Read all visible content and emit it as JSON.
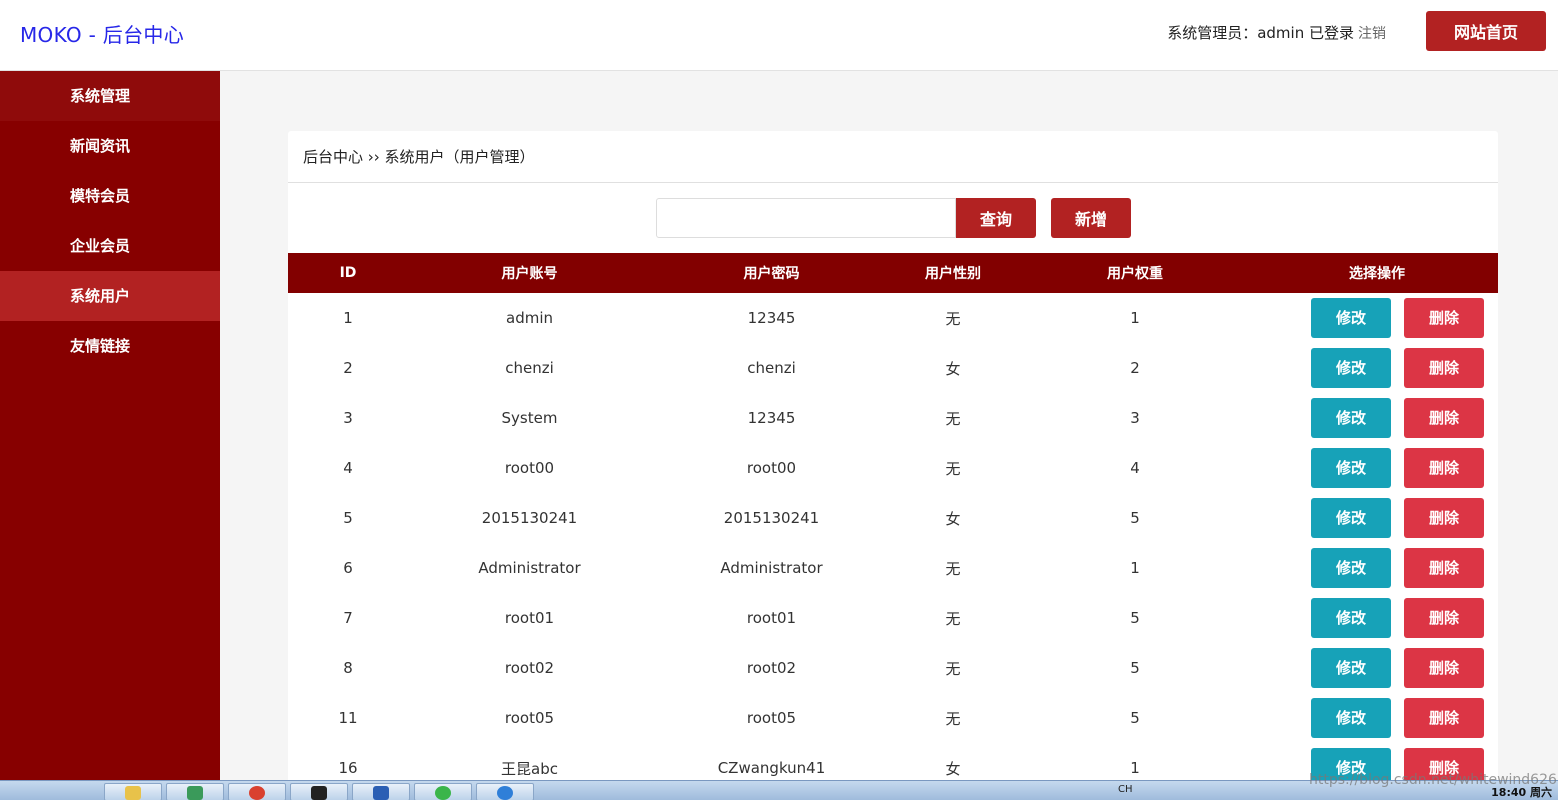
{
  "header": {
    "brand": "MOKO - 后台中心",
    "admin_text": "系统管理员：admin 已登录",
    "logout": "注销",
    "home_button": "网站首页"
  },
  "sidebar": {
    "items": [
      {
        "label": "系统管理"
      },
      {
        "label": "新闻资讯"
      },
      {
        "label": "模特会员"
      },
      {
        "label": "企业会员"
      },
      {
        "label": "系统用户"
      },
      {
        "label": "友情链接"
      }
    ],
    "active_index": 4
  },
  "main": {
    "breadcrumb": "后台中心 ›› 系统用户（用户管理）",
    "search": {
      "value": "",
      "placeholder": ""
    },
    "query_button": "查询",
    "add_button": "新增",
    "table": {
      "headers": [
        "ID",
        "用户账号",
        "用户密码",
        "用户性别",
        "用户权重",
        "选择操作"
      ],
      "edit_label": "修改",
      "delete_label": "删除",
      "rows": [
        {
          "id": "1",
          "account": "admin",
          "password": "12345",
          "gender": "无",
          "weight": "1"
        },
        {
          "id": "2",
          "account": "chenzi",
          "password": "chenzi",
          "gender": "女",
          "weight": "2"
        },
        {
          "id": "3",
          "account": "System",
          "password": "12345",
          "gender": "无",
          "weight": "3"
        },
        {
          "id": "4",
          "account": "root00",
          "password": "root00",
          "gender": "无",
          "weight": "4"
        },
        {
          "id": "5",
          "account": "2015130241",
          "password": "2015130241",
          "gender": "女",
          "weight": "5"
        },
        {
          "id": "6",
          "account": "Administrator",
          "password": "Administrator",
          "gender": "无",
          "weight": "1"
        },
        {
          "id": "7",
          "account": "root01",
          "password": "root01",
          "gender": "无",
          "weight": "5"
        },
        {
          "id": "8",
          "account": "root02",
          "password": "root02",
          "gender": "无",
          "weight": "5"
        },
        {
          "id": "11",
          "account": "root05",
          "password": "root05",
          "gender": "无",
          "weight": "5"
        },
        {
          "id": "16",
          "account": "王昆abc",
          "password": "CZwangkun41",
          "gender": "女",
          "weight": "1"
        }
      ]
    }
  },
  "colors": {
    "brand_blue": "#2727e8",
    "sidebar_bg": "#870000",
    "sidebar_active": "#b22222",
    "primary_red": "#b22222",
    "table_header": "#820000",
    "edit_teal": "#17a2b8",
    "delete_red": "#dc3545"
  },
  "taskbar": {
    "watermark": "https://blog.csdn.net/whitewind626",
    "tray_lang": "CH",
    "clock": "18:40 周六"
  }
}
